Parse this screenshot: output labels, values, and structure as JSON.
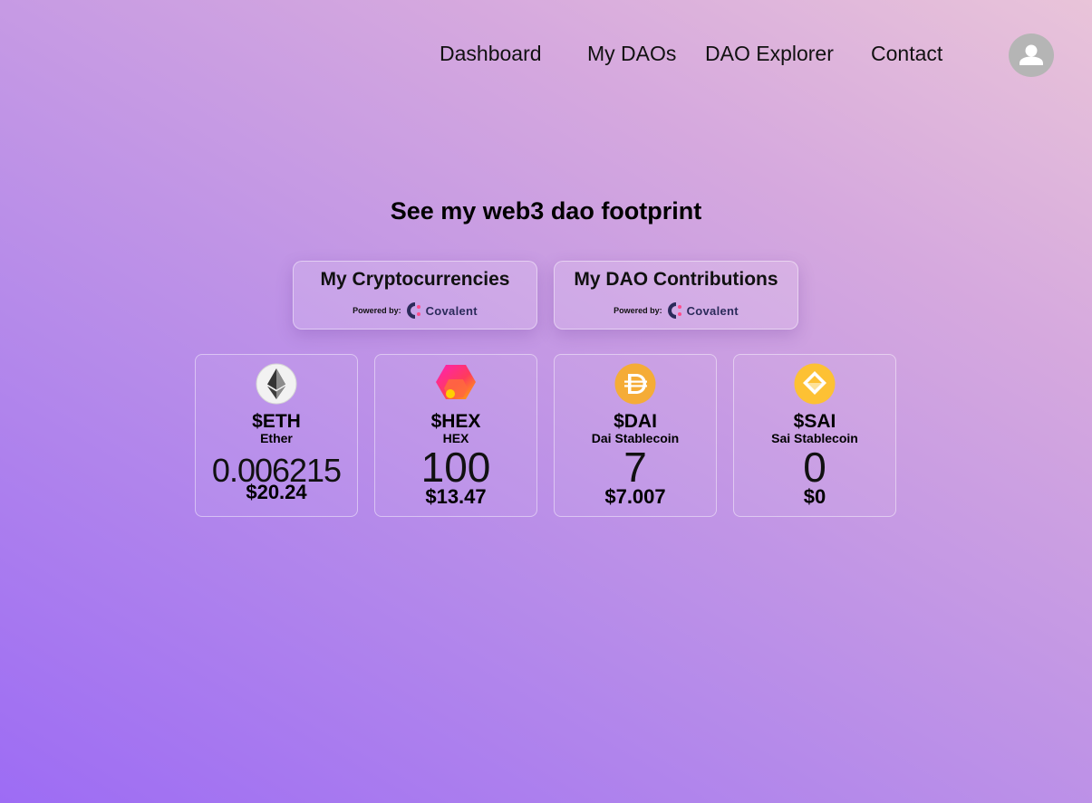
{
  "nav": {
    "links": [
      "Dashboard",
      "My DAOs",
      "DAO Explorer",
      "Contact"
    ],
    "avatar_icon": "user-avatar-icon"
  },
  "headline": "See my web3 dao footprint",
  "tabs": [
    {
      "title": "My Cryptocurrencies",
      "powered_label": "Powered by:",
      "provider": "Covalent"
    },
    {
      "title": "My DAO Contributions",
      "powered_label": "Powered by:",
      "provider": "Covalent"
    }
  ],
  "tokens": [
    {
      "symbol": "$ETH",
      "name": "Ether",
      "balance": "0.006215",
      "usd": "$20.24",
      "icon": "ethereum-icon",
      "color": "#333333"
    },
    {
      "symbol": "$HEX",
      "name": "HEX",
      "balance": "100",
      "usd": "$13.47",
      "icon": "hex-icon",
      "color": "#ff3b7a"
    },
    {
      "symbol": "$DAI",
      "name": "Dai Stablecoin",
      "balance": "7",
      "usd": "$7.007",
      "icon": "dai-icon",
      "color": "#f5ac37"
    },
    {
      "symbol": "$SAI",
      "name": "Sai Stablecoin",
      "balance": "0",
      "usd": "$0",
      "icon": "sai-icon",
      "color": "#fdc134"
    }
  ]
}
